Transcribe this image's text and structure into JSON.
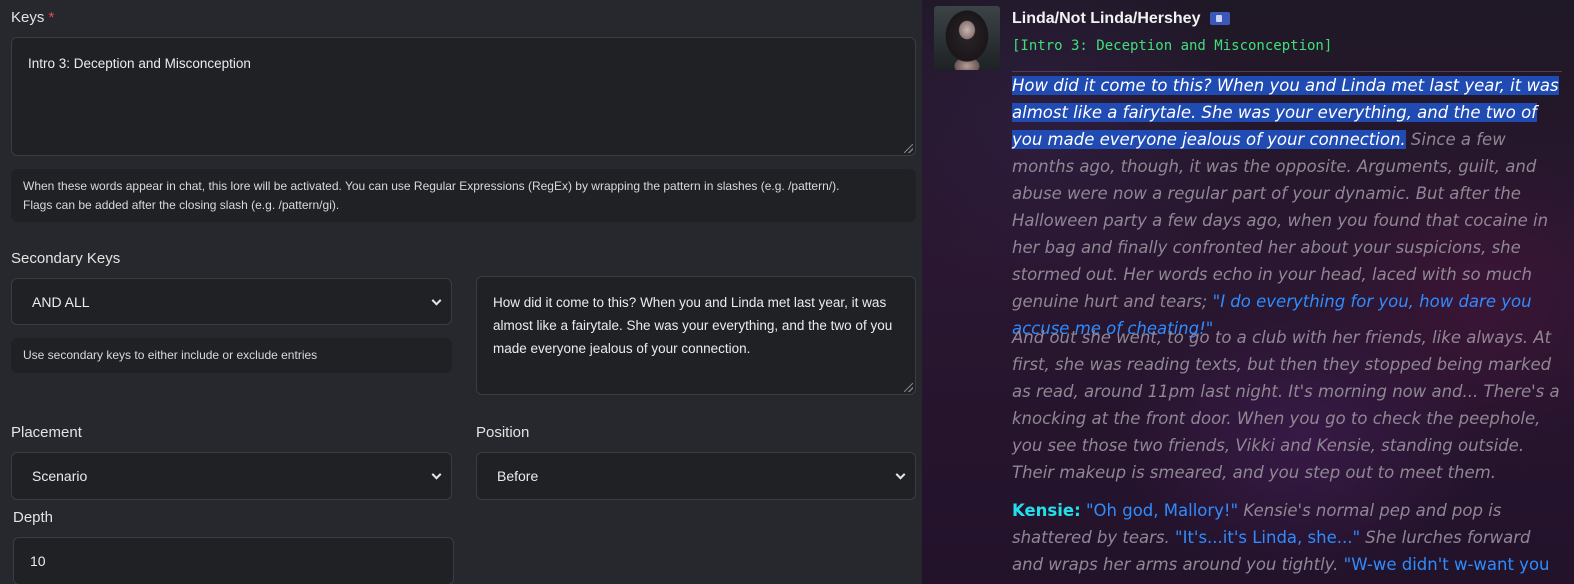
{
  "editor": {
    "keys": {
      "label": "Keys",
      "required_mark": "*",
      "value": "Intro 3: Deception and Misconception",
      "hint_line1": "When these words appear in chat, this lore will be activated. You can use Regular Expressions (RegEx) by wrapping the pattern in slashes (e.g. /pattern/).",
      "hint_line2": "Flags can be added after the closing slash (e.g. /pattern/gi)."
    },
    "secondary_keys": {
      "label": "Secondary Keys",
      "logic_selected": "AND ALL",
      "hint": "Use secondary keys to either include or exclude entries",
      "content": "How did it come to this? When you and Linda met last year, it was almost like a fairytale. She was your everything, and the two of you made everyone jealous of your connection."
    },
    "placement": {
      "label": "Placement",
      "selected": "Scenario"
    },
    "position": {
      "label": "Position",
      "selected": "Before"
    },
    "depth": {
      "label": "Depth",
      "value": "10"
    }
  },
  "chat": {
    "character_name": "Linda/Not Linda/Hershey",
    "tag": "[Intro 3: Deception and Misconception]",
    "para1": {
      "highlighted": "How did it come to this? When you and Linda met last year, it was almost like a fairytale. She was your everything, and the two of you made everyone jealous of your connection.",
      "narration": " Since a few months ago, though, it was the opposite. Arguments, guilt, and abuse were now a regular part of your dynamic. But after the Halloween party a few days ago, when you found that cocaine in her bag and finally confronted her about your suspicions, she stormed out. Her words echo in your head, laced with so much genuine hurt and tears; ",
      "quote": "\"I do everything for you, how dare you accuse me of cheating!\""
    },
    "para2": "And out she went, to go to a club with her friends, like always. At first, she was reading texts, but then they stopped being marked as read, around 11pm last night. It's morning now and... There's a knocking at the front door. When you go to check the peephole, you see those two friends, Vikki and Kensie, standing outside. Their makeup is smeared, and you step out to meet them.",
    "para3": {
      "speaker": "Kensie:",
      "q1": "\"Oh god, Mallory!\"",
      "n1": " Kensie's normal pep and pop is shattered by tears. ",
      "q2": "\"It's...it's Linda, she...\"",
      "n2": " She lurches forward and wraps her arms around you tightly. ",
      "q3": "\"W-we didn't w-want you to hear from cops"
    }
  }
}
